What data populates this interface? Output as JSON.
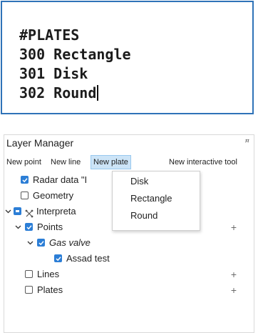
{
  "editor": {
    "lines": [
      "#PLATES",
      "300 Rectangle",
      "301 Disk",
      "302 Round"
    ]
  },
  "layer_manager": {
    "title": "Layer Manager",
    "float_icon": "float-window-icon",
    "float_glyph": "ꟸ",
    "toolbar": {
      "new_point": "New point",
      "new_line": "New line",
      "new_plate": "New plate",
      "new_interactive_tool": "New interactive tool"
    },
    "tree": {
      "radar": "Radar data \"I",
      "geometry": "Geometry",
      "interpretation": "Interpreta",
      "points": "Points",
      "gas_valve": "Gas valve",
      "assad_test": "Assad test",
      "lines": "Lines",
      "plates": "Plates"
    },
    "plus": "+",
    "dropdown": {
      "items": [
        "Disk",
        "Rectangle",
        "Round"
      ]
    }
  },
  "colors": {
    "accent": "#2c7ed6",
    "editor_border": "#2f73b8",
    "active_button_bg": "#cce4f7"
  }
}
